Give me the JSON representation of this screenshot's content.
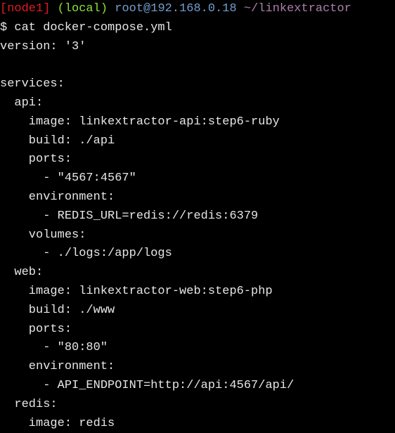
{
  "prompt": {
    "node": "[node1]",
    "local": "(local)",
    "host": "root@192.168.0.18",
    "path": "~/linkextractor"
  },
  "colors": {
    "background": "#000000",
    "text": "#e6e6e6",
    "node": "#e01b24",
    "local": "#8ae234",
    "host": "#729fcf",
    "path": "#ad7fa8"
  },
  "lines": [
    "$ cat docker-compose.yml",
    "version: '3'",
    "",
    "services:",
    "  api:",
    "    image: linkextractor-api:step6-ruby",
    "    build: ./api",
    "    ports:",
    "      - \"4567:4567\"",
    "    environment:",
    "      - REDIS_URL=redis://redis:6379",
    "    volumes:",
    "      - ./logs:/app/logs",
    "  web:",
    "    image: linkextractor-web:step6-php",
    "    build: ./www",
    "    ports:",
    "      - \"80:80\"",
    "    environment:",
    "      - API_ENDPOINT=http://api:4567/api/",
    "  redis:",
    "    image: redis"
  ]
}
